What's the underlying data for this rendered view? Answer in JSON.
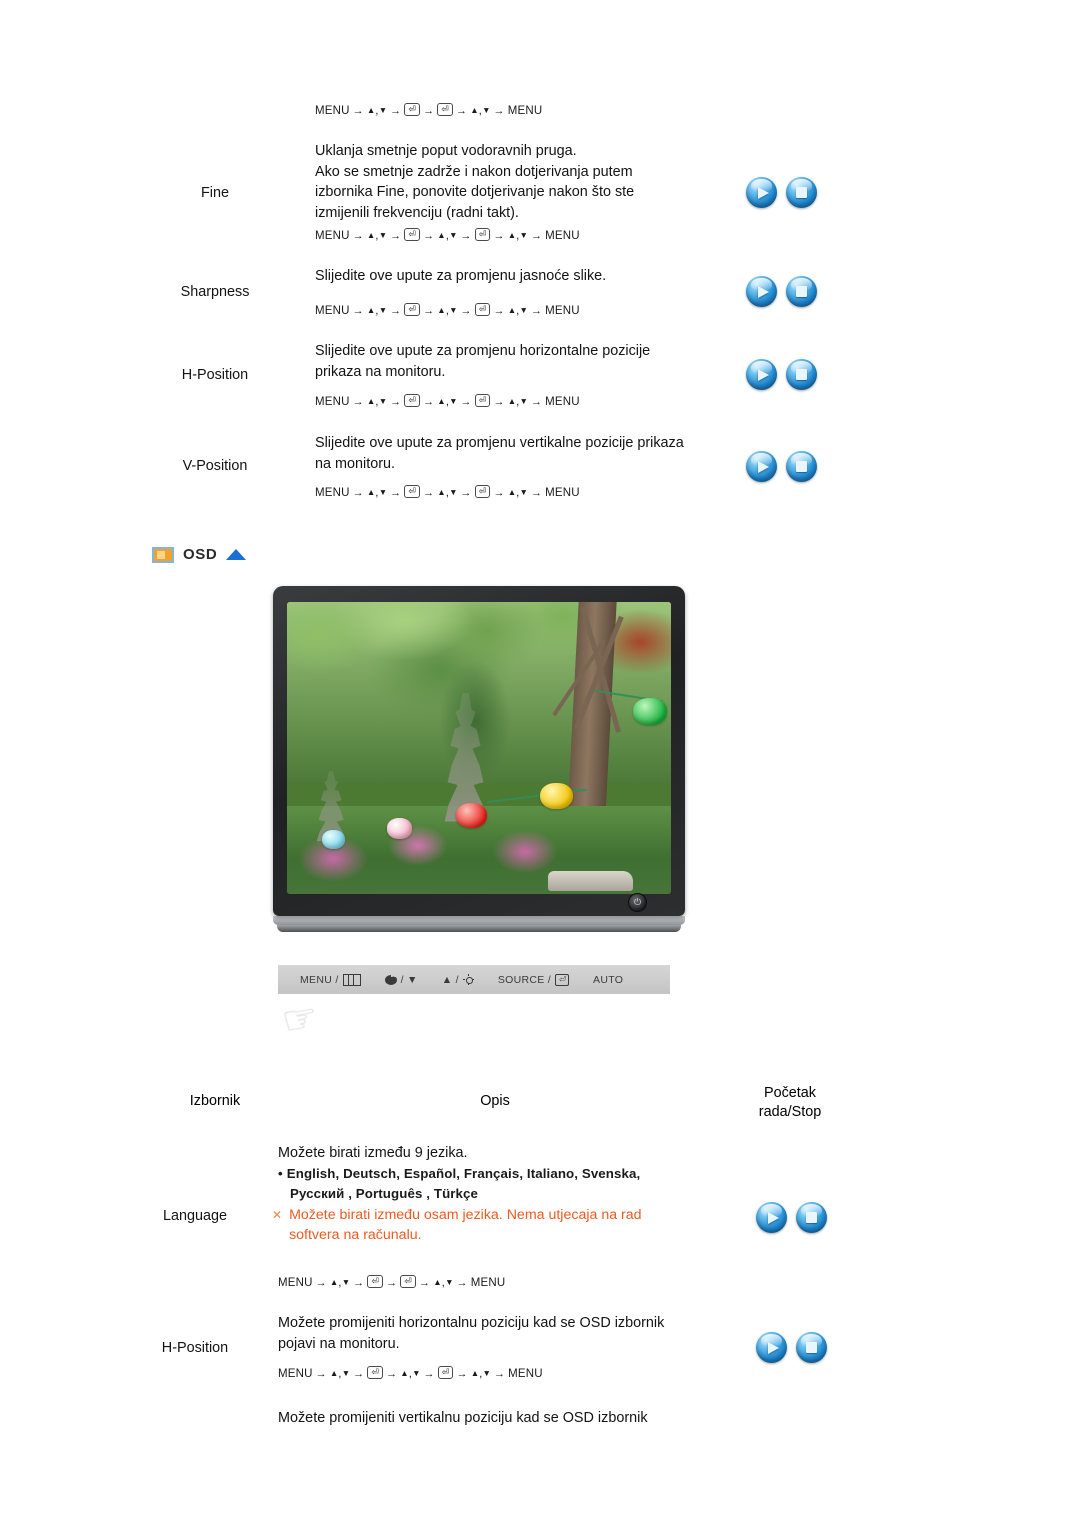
{
  "document": {
    "language": "hr",
    "accent_orange": "#f05a20",
    "accent_blue": "#1b6fd4"
  },
  "key_sequences": {
    "two_enter": "MENU → ▲,▼ → ⏎ → ⏎ → ▲,▼ → MENU",
    "three_step": "MENU → ▲,▼ → ⏎ → ▲,▼ → ⏎ → ▲,▼ → MENU"
  },
  "top_section": {
    "lead_keyline": "MENU → ▲,▼ → ⏎ → ⏎ → ▲,▼ → MENU",
    "rows": [
      {
        "label": "Fine",
        "description": "Uklanja smetnje poput vodoravnih pruga.\nAko se smetnje zadrže i nakon dotjerivanja putem\nizbornika Fine, ponovite dotjerivanje nakon što ste\nizmijenili frekvenciju (radni takt).",
        "keyline": "MENU → ▲,▼ → ⏎ → ▲,▼ → ⏎ → ▲,▼ → MENU",
        "buttons": [
          "play",
          "stop"
        ]
      },
      {
        "label": "Sharpness",
        "description": "Slijedite ove upute za promjenu jasnoće slike.",
        "keyline": "MENU → ▲,▼ → ⏎ → ▲,▼ → ⏎ → ▲,▼ → MENU",
        "buttons": [
          "play",
          "stop"
        ]
      },
      {
        "label": "H-Position",
        "description": "Slijedite ove upute za promjenu horizontalne pozicije\nprikaza na monitoru.",
        "keyline": "MENU → ▲,▼ → ⏎ → ▲,▼ → ⏎ → ▲,▼ → MENU",
        "buttons": [
          "play",
          "stop"
        ]
      },
      {
        "label": "V-Position",
        "description": "Slijedite ove upute za promjenu vertikalne pozicije prikaza\nna monitoru.",
        "keyline": "MENU → ▲,▼ → ⏎ → ▲,▼ → ⏎ → ▲,▼ → MENU",
        "buttons": [
          "play",
          "stop"
        ]
      }
    ]
  },
  "osd_section": {
    "heading": "OSD",
    "monitor_icon": "monitor-icon",
    "up_arrow_icon": "triangle-up-icon",
    "monitor": {
      "screen_image_alt": "Vrt s kamenom pagodom i šarenim lampionima",
      "power_icon": "power-icon"
    },
    "control_bar": {
      "buttons": [
        {
          "label": "MENU /",
          "icon": "menu-icon"
        },
        {
          "label": "/ ▼",
          "icon": "contrast-icon"
        },
        {
          "label": "▲ /",
          "icon": "brightness-icon"
        },
        {
          "label": "SOURCE /",
          "icon": "enter-icon"
        },
        {
          "label": "AUTO",
          "icon": ""
        }
      ]
    },
    "hand_icon": "hand-pointing-icon"
  },
  "table": {
    "headers": {
      "menu": "Izbornik",
      "description": "Opis",
      "playstop_line1": "Početak",
      "playstop_line2": "rada/Stop"
    },
    "rows": [
      {
        "label": "Language",
        "description": "Možete birati između 9 jezika.",
        "languages_line1": "English, Deutsch, Español, Français,  Italiano, Svenska,",
        "languages_line2": "Русский , Português , Türkçe",
        "bullet": "•",
        "warning_mark": "✕",
        "warning": "Možete birati između osam jezika. Nema utjecaja na rad\nsoftvera na računalu.",
        "keyline": "MENU → ▲,▼ → ⏎ → ⏎ → ▲,▼ → MENU",
        "buttons": [
          "play",
          "stop"
        ]
      },
      {
        "label": "H-Position",
        "description": "Možete promijeniti horizontalnu poziciju kad se OSD izbornik\npojavi na monitoru.",
        "keyline": "MENU → ▲,▼ → ⏎ → ▲,▼ → ⏎ → ▲,▼ → MENU",
        "buttons": [
          "play",
          "stop"
        ]
      },
      {
        "label": "",
        "description": "Možete promijeniti vertikalnu poziciju kad se OSD izbornik",
        "keyline": "",
        "buttons": []
      }
    ]
  }
}
